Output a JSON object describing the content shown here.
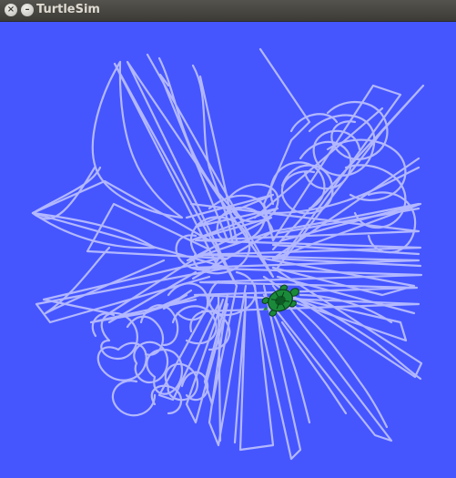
{
  "window": {
    "title": "TurtleSim",
    "close_glyph": "×",
    "minimize_glyph": "–"
  },
  "colors": {
    "background": "#4556ff",
    "pen": "#b3b8ff",
    "turtle_body": "#1a8a3a",
    "turtle_shell": "#0d5a24"
  }
}
